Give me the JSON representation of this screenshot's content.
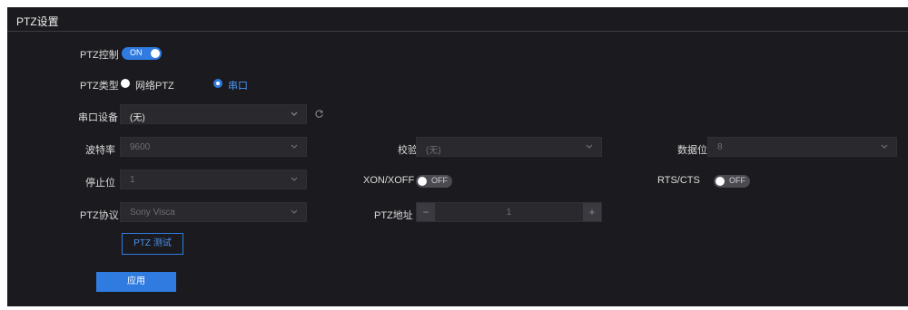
{
  "page": {
    "title": "PTZ设置"
  },
  "ptz_control": {
    "label": "PTZ控制",
    "toggle_text": "ON",
    "state": "on"
  },
  "ptz_type": {
    "label": "PTZ类型",
    "options": [
      {
        "label": "网络PTZ",
        "selected": false
      },
      {
        "label": "串口",
        "selected": true
      }
    ]
  },
  "serial_device": {
    "label": "串口设备",
    "value": "(无)"
  },
  "baud_rate": {
    "label": "波特率",
    "value": "9600"
  },
  "parity": {
    "label": "校验",
    "value": "(无)"
  },
  "data_bits": {
    "label": "数据位",
    "value": "8"
  },
  "stop_bits": {
    "label": "停止位",
    "value": "1"
  },
  "xon_xoff": {
    "label": "XON/XOFF",
    "toggle_text": "OFF",
    "state": "off"
  },
  "rts_cts": {
    "label": "RTS/CTS",
    "toggle_text": "OFF",
    "state": "off"
  },
  "ptz_protocol": {
    "label": "PTZ协议",
    "value": "Sony Visca"
  },
  "ptz_address": {
    "label": "PTZ地址",
    "value": "1",
    "minus": "−",
    "plus": "+"
  },
  "buttons": {
    "test": "PTZ 测试",
    "apply": "应用"
  },
  "colors": {
    "accent": "#2f7be0",
    "panel_bg": "#1b1b1f",
    "field_bg": "#2a2a2e"
  }
}
